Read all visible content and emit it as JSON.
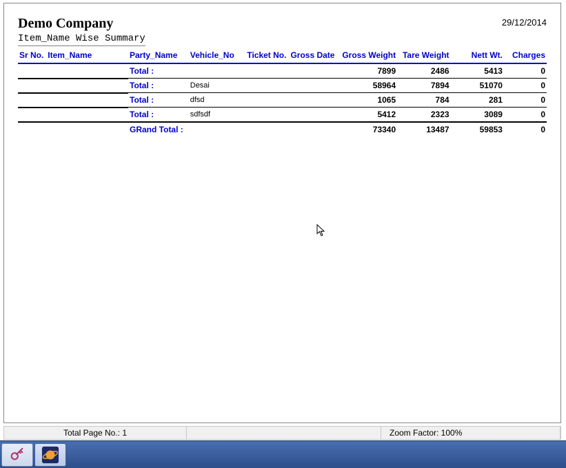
{
  "header": {
    "company": "Demo Company",
    "subtitle": "Item_Name Wise Summary",
    "date": "29/12/2014"
  },
  "columns": {
    "sr_no": "Sr No.",
    "item_name": "Item_Name",
    "party_name": "Party_Name",
    "vehicle_no": "Vehicle_No",
    "ticket_no": "Ticket No.",
    "gross_date": "Gross Date",
    "gross_weight": "Gross Weight",
    "tare_weight": "Tare Weight",
    "nett_wt": "Nett Wt.",
    "charges": "Charges"
  },
  "rows": [
    {
      "label": "Total :",
      "vehicle": "",
      "gross": "7899",
      "tare": "2486",
      "nett": "5413",
      "charges": "0"
    },
    {
      "label": "Total :",
      "vehicle": "Desai",
      "gross": "58964",
      "tare": "7894",
      "nett": "51070",
      "charges": "0"
    },
    {
      "label": "Total :",
      "vehicle": "dfsd",
      "gross": "1065",
      "tare": "784",
      "nett": "281",
      "charges": "0"
    },
    {
      "label": "Total :",
      "vehicle": "sdfsdf",
      "gross": "5412",
      "tare": "2323",
      "nett": "3089",
      "charges": "0"
    }
  ],
  "grand": {
    "label": "GRand Total :",
    "gross": "73340",
    "tare": "13487",
    "nett": "59853",
    "charges": "0"
  },
  "status": {
    "page_label": "Total Page No.: 1",
    "zoom_label": "Zoom Factor: 100%"
  }
}
